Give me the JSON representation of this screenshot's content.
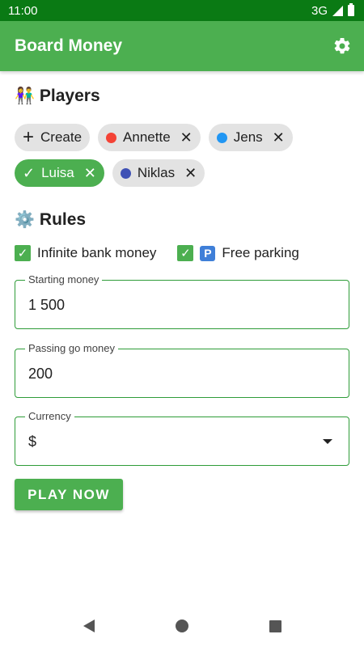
{
  "status_bar": {
    "time": "11:00",
    "network": "3G"
  },
  "app_bar": {
    "title": "Board Money",
    "settings_icon": "gear-icon"
  },
  "players": {
    "heading": "Players",
    "heading_emoji": "👫",
    "create_label": "Create",
    "chips": [
      {
        "name": "Annette",
        "color": "#f44336",
        "selected": false
      },
      {
        "name": "Jens",
        "color": "#2196f3",
        "selected": false
      },
      {
        "name": "Luisa",
        "color": "#4caf50",
        "selected": true
      },
      {
        "name": "Niklas",
        "color": "#3f51b5",
        "selected": false
      }
    ],
    "close_glyph": "✕"
  },
  "rules": {
    "heading": "Rules",
    "heading_emoji": "⚙️",
    "infinite_bank_label": "Infinite bank money",
    "infinite_bank_checked": true,
    "free_parking_label": "Free parking",
    "free_parking_badge": "P",
    "free_parking_checked": true
  },
  "fields": {
    "starting_money": {
      "label": "Starting money",
      "value": "1 500"
    },
    "passing_go": {
      "label": "Passing go money",
      "value": "200"
    },
    "currency": {
      "label": "Currency",
      "value": "$"
    }
  },
  "play_button": "PLAY NOW",
  "colors": {
    "primary": "#4caf50",
    "status_bar": "#0a7a14"
  }
}
